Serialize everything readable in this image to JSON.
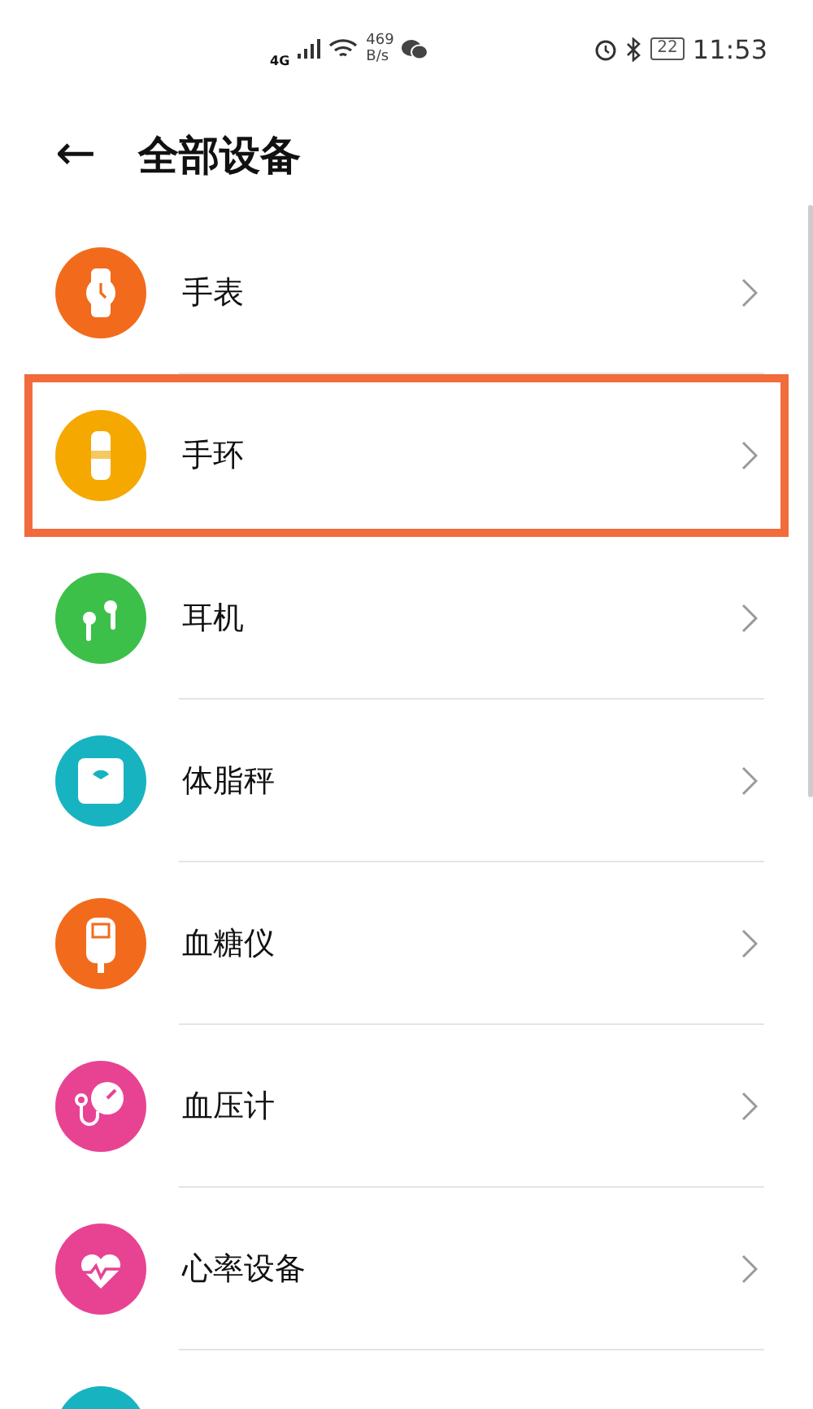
{
  "status_bar": {
    "network": "4G",
    "speed_value": "469",
    "speed_unit": "B/s",
    "battery": "22",
    "time": "11:53"
  },
  "header": {
    "back": "←",
    "title": "全部设备"
  },
  "devices": [
    {
      "label": "手表",
      "kind": "watch",
      "color": "#f26b1d",
      "highlighted": false
    },
    {
      "label": "手环",
      "kind": "band",
      "color": "#f5a800",
      "highlighted": true
    },
    {
      "label": "耳机",
      "kind": "earphones",
      "color": "#3cc04a",
      "highlighted": false
    },
    {
      "label": "体脂秤",
      "kind": "scale",
      "color": "#17b3c1",
      "highlighted": false
    },
    {
      "label": "血糖仪",
      "kind": "glucose",
      "color": "#f26b1d",
      "highlighted": false
    },
    {
      "label": "血压计",
      "kind": "pressure",
      "color": "#e84393",
      "highlighted": false
    },
    {
      "label": "心率设备",
      "kind": "heart",
      "color": "#e84393",
      "highlighted": false
    },
    {
      "kind": "partial",
      "color": "#17b3c1",
      "highlighted": false
    }
  ]
}
